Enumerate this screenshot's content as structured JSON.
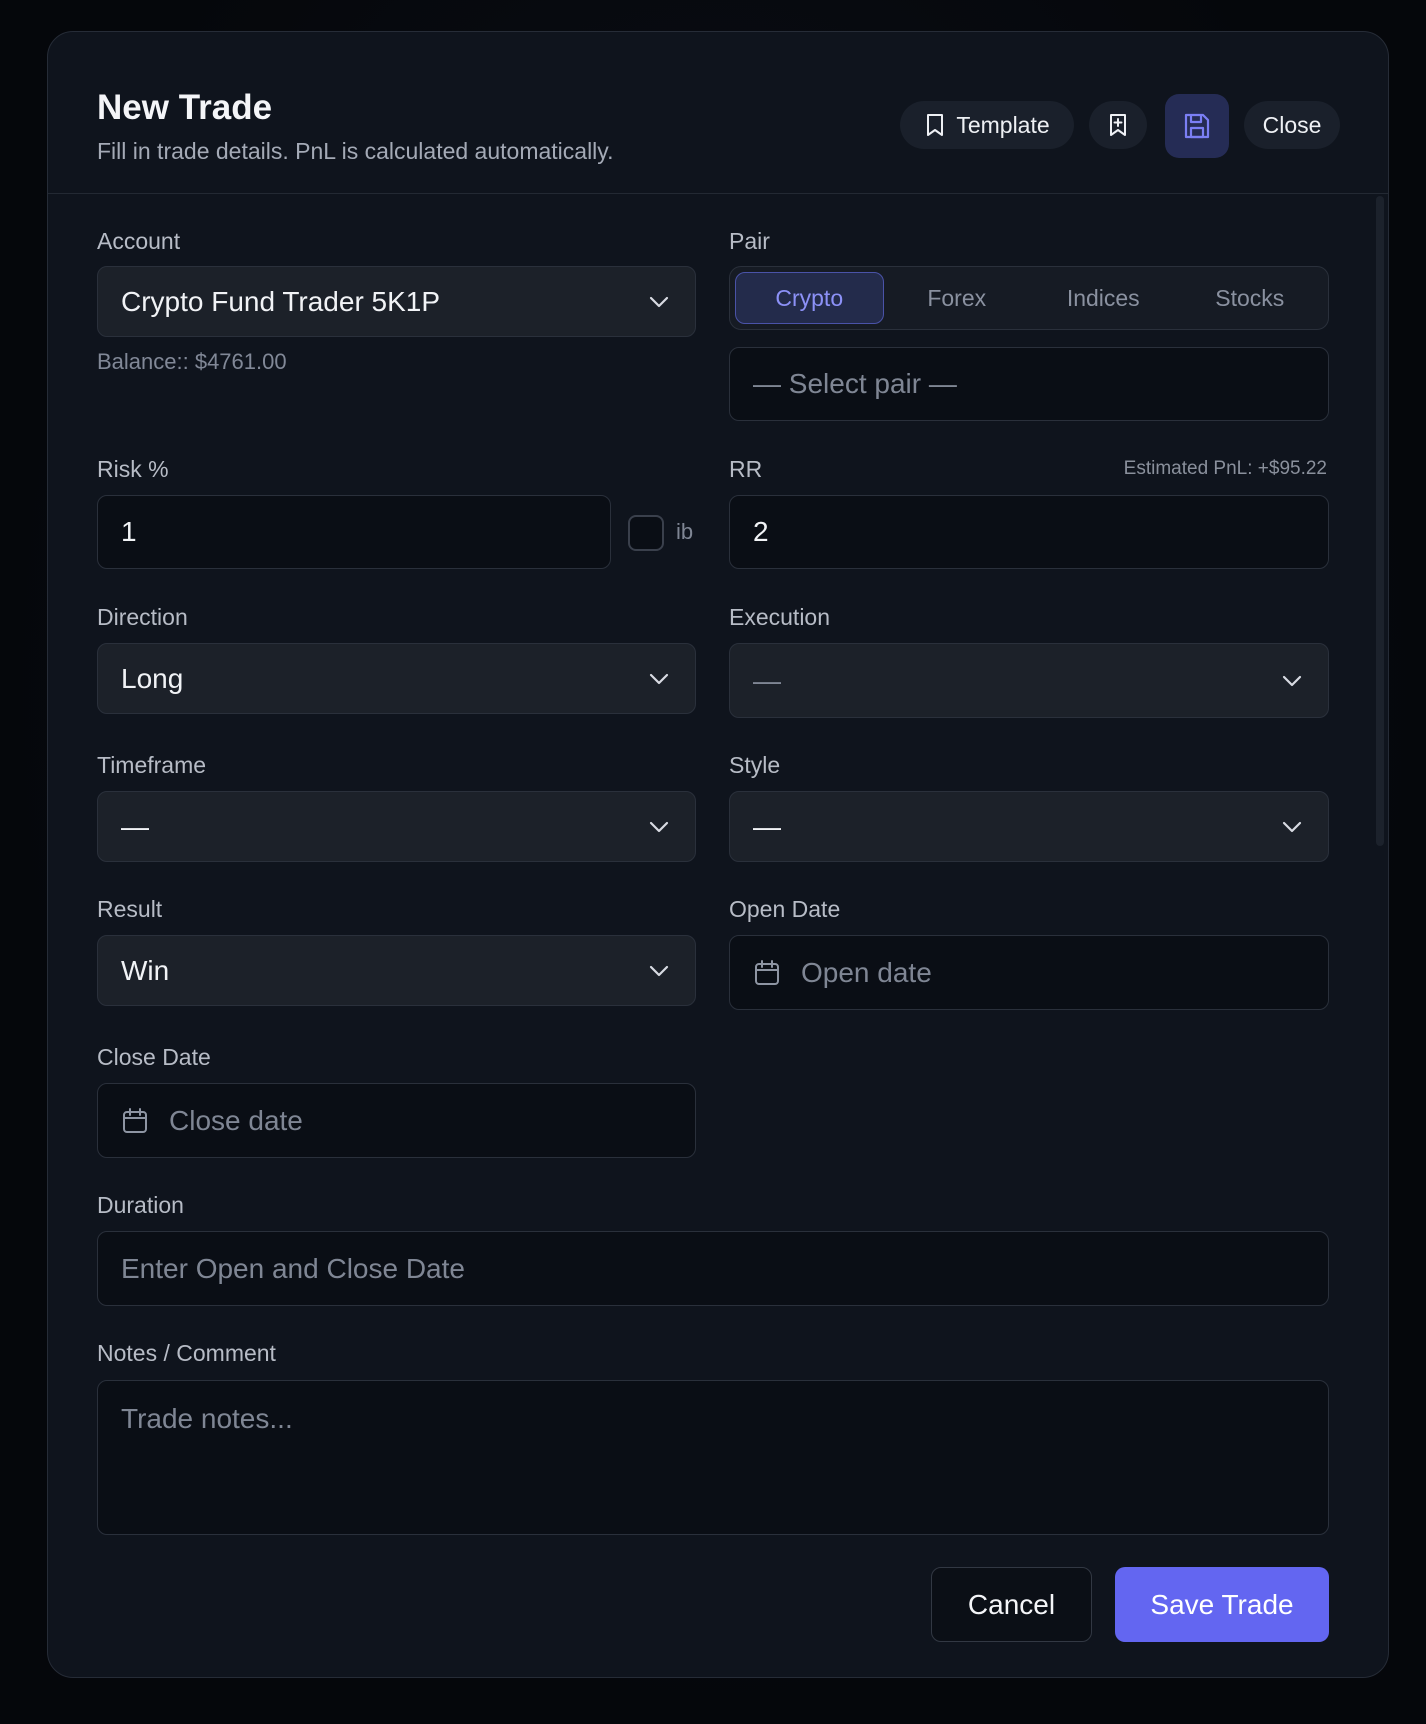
{
  "header": {
    "title": "New Trade",
    "subtitle": "Fill in trade details. PnL is calculated automatically.",
    "template_label": "Template",
    "close_label": "Close"
  },
  "account": {
    "label": "Account",
    "value": "Crypto Fund Trader 5K1P",
    "balance": "Balance:: $4761.00"
  },
  "pair": {
    "label": "Pair",
    "tabs": [
      "Crypto",
      "Forex",
      "Indices",
      "Stocks"
    ],
    "active_tab": "Crypto",
    "placeholder": "— Select pair —"
  },
  "risk": {
    "label": "Risk %",
    "value": "1",
    "checkbox_label": "ib"
  },
  "rr": {
    "label": "RR",
    "value": "2",
    "estimated_pnl": "Estimated PnL: +$95.22"
  },
  "direction": {
    "label": "Direction",
    "value": "Long"
  },
  "execution": {
    "label": "Execution",
    "value": "—"
  },
  "timeframe": {
    "label": "Timeframe",
    "value": "—"
  },
  "style": {
    "label": "Style",
    "value": "—"
  },
  "result": {
    "label": "Result",
    "value": "Win"
  },
  "open_date": {
    "label": "Open Date",
    "placeholder": "Open date"
  },
  "close_date": {
    "label": "Close Date",
    "placeholder": "Close date"
  },
  "duration": {
    "label": "Duration",
    "placeholder": "Enter Open and Close Date"
  },
  "notes": {
    "label": "Notes / Comment",
    "placeholder": "Trade notes..."
  },
  "footer": {
    "cancel_label": "Cancel",
    "save_label": "Save Trade"
  },
  "colors": {
    "accent": "#6366f1",
    "modal_bg": "#0f141d",
    "active_tab_text": "#8c91f7"
  },
  "icons": [
    "bookmark-icon",
    "bookmark-plus-icon",
    "floppy-disk-icon",
    "chevron-down-icon",
    "calendar-icon"
  ]
}
